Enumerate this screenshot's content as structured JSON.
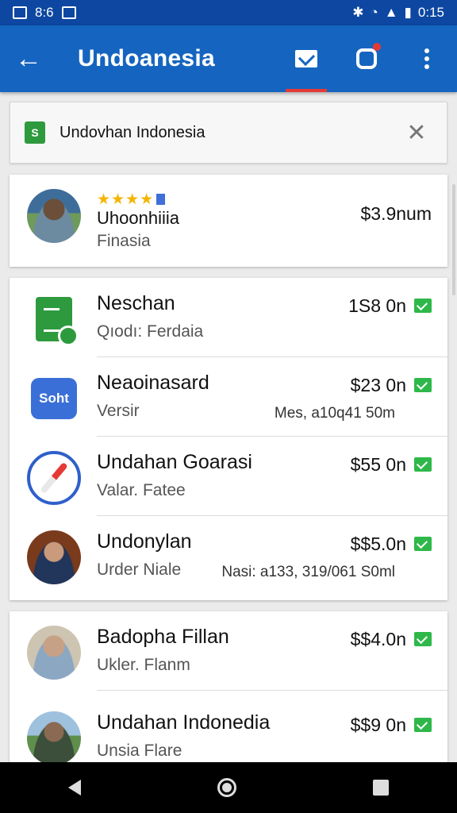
{
  "status_bar": {
    "time_left": "8:6",
    "time_right": "0:15"
  },
  "app_bar": {
    "title": "Undoanesia"
  },
  "banner": {
    "text": "Undovhan Indonesia",
    "icon_label": "S"
  },
  "featured": {
    "rating_stars": "★★★★",
    "name": "Uhoonhiiia",
    "subtitle": "Finasia",
    "price": "$3.9num"
  },
  "list": [
    {
      "name": "Neschan",
      "subtitle": "Qıodı: Ferdaia",
      "price": "1S8 0n",
      "note": "",
      "avatar": "sheets-app-icon"
    },
    {
      "name": "Neaoinasard",
      "subtitle": "Versir",
      "price": "$23 0n",
      "note": "Mes, a10q41 50m",
      "avatar": "chat-app-icon",
      "avatar_label": "Soht"
    },
    {
      "name": "Undahan Goarasi",
      "subtitle": "Valar. Fatee",
      "price": "$55 0n",
      "note": "",
      "avatar": "compass-app-icon"
    },
    {
      "name": "Undonylan",
      "subtitle": "Urder Niale",
      "price": "$$5.0n",
      "note": "Nasi: a133, 319/061 S0ml",
      "avatar": "person-avatar"
    }
  ],
  "list2": [
    {
      "name": "Badopha Fillan",
      "subtitle": "Ukler. Flanm",
      "price": "$$4.0n",
      "avatar": "person-avatar"
    },
    {
      "name": "Undahan Indonedia",
      "subtitle": "Unsia Flare",
      "price": "$$9 0n",
      "avatar": "person-avatar"
    }
  ],
  "colors": {
    "app_bar": "#1565c0",
    "status_bar": "#0d47a1",
    "check": "#2eb84a",
    "accent_red": "#e53935"
  }
}
